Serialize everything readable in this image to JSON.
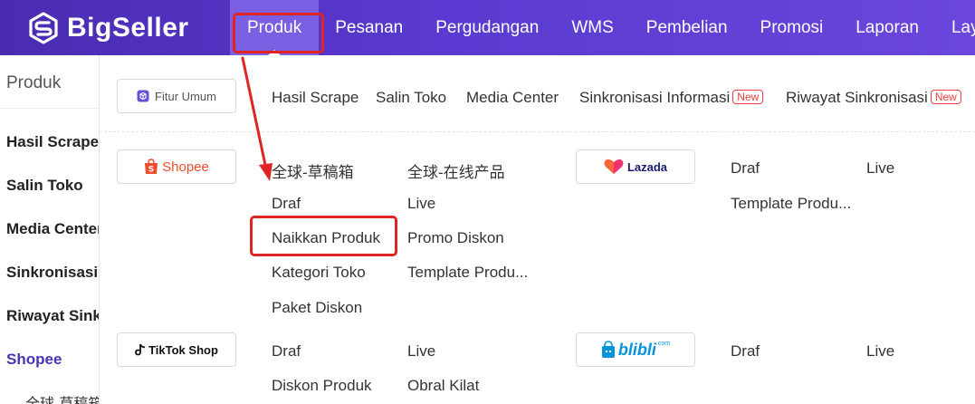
{
  "brand": {
    "name": "BigSeller"
  },
  "nav": {
    "items": [
      {
        "label": "Produk"
      },
      {
        "label": "Pesanan"
      },
      {
        "label": "Pergudangan"
      },
      {
        "label": "WMS"
      },
      {
        "label": "Pembelian"
      },
      {
        "label": "Promosi"
      },
      {
        "label": "Laporan"
      },
      {
        "label": "Lay"
      }
    ]
  },
  "sidebar": {
    "title": "Produk",
    "items": [
      {
        "label": "Hasil Scrape"
      },
      {
        "label": "Salin Toko"
      },
      {
        "label": "Media Center"
      },
      {
        "label": "Sinkronisasi Informasi"
      },
      {
        "label": "Riwayat Sinkronisasi"
      },
      {
        "label": "Shopee"
      }
    ],
    "sub": {
      "label": "全球-草稿箱"
    }
  },
  "general": {
    "chip_label": "Fitur Umum",
    "links": [
      {
        "label": "Hasil Scrape"
      },
      {
        "label": "Salin Toko"
      },
      {
        "label": "Media Center"
      },
      {
        "label": "Sinkronisasi Informasi",
        "badge": "New"
      },
      {
        "label": "Riwayat Sinkronisasi",
        "badge": "New"
      }
    ]
  },
  "shopee": {
    "chip_label": "Shopee",
    "links": [
      {
        "label": "全球-草稿箱"
      },
      {
        "label": "全球-在线产品"
      },
      {
        "label": "Draf"
      },
      {
        "label": "Live"
      },
      {
        "label": "Naikkan Produk"
      },
      {
        "label": "Promo Diskon"
      },
      {
        "label": "Kategori Toko"
      },
      {
        "label": "Template Produ..."
      },
      {
        "label": "Paket Diskon"
      }
    ]
  },
  "lazada": {
    "chip_label": "Lazada",
    "links": [
      {
        "label": "Draf"
      },
      {
        "label": "Live"
      },
      {
        "label": "Template Produ..."
      }
    ]
  },
  "tiktok": {
    "chip_label": "TikTok Shop",
    "links": [
      {
        "label": "Draf"
      },
      {
        "label": "Live"
      },
      {
        "label": "Diskon Produk"
      },
      {
        "label": "Obral Kilat"
      }
    ]
  },
  "blibli": {
    "chip_label": "blibli",
    "chip_sup": ".com",
    "links": [
      {
        "label": "Draf"
      },
      {
        "label": "Live"
      }
    ]
  },
  "colors": {
    "brand_purple": "#4a2bb0",
    "nav_active": "#7a5fe2",
    "highlight_red": "#e02424",
    "shopee_orange": "#ee4d2d",
    "lazada_pink": "#f0326e",
    "blibli_blue": "#0095da"
  }
}
